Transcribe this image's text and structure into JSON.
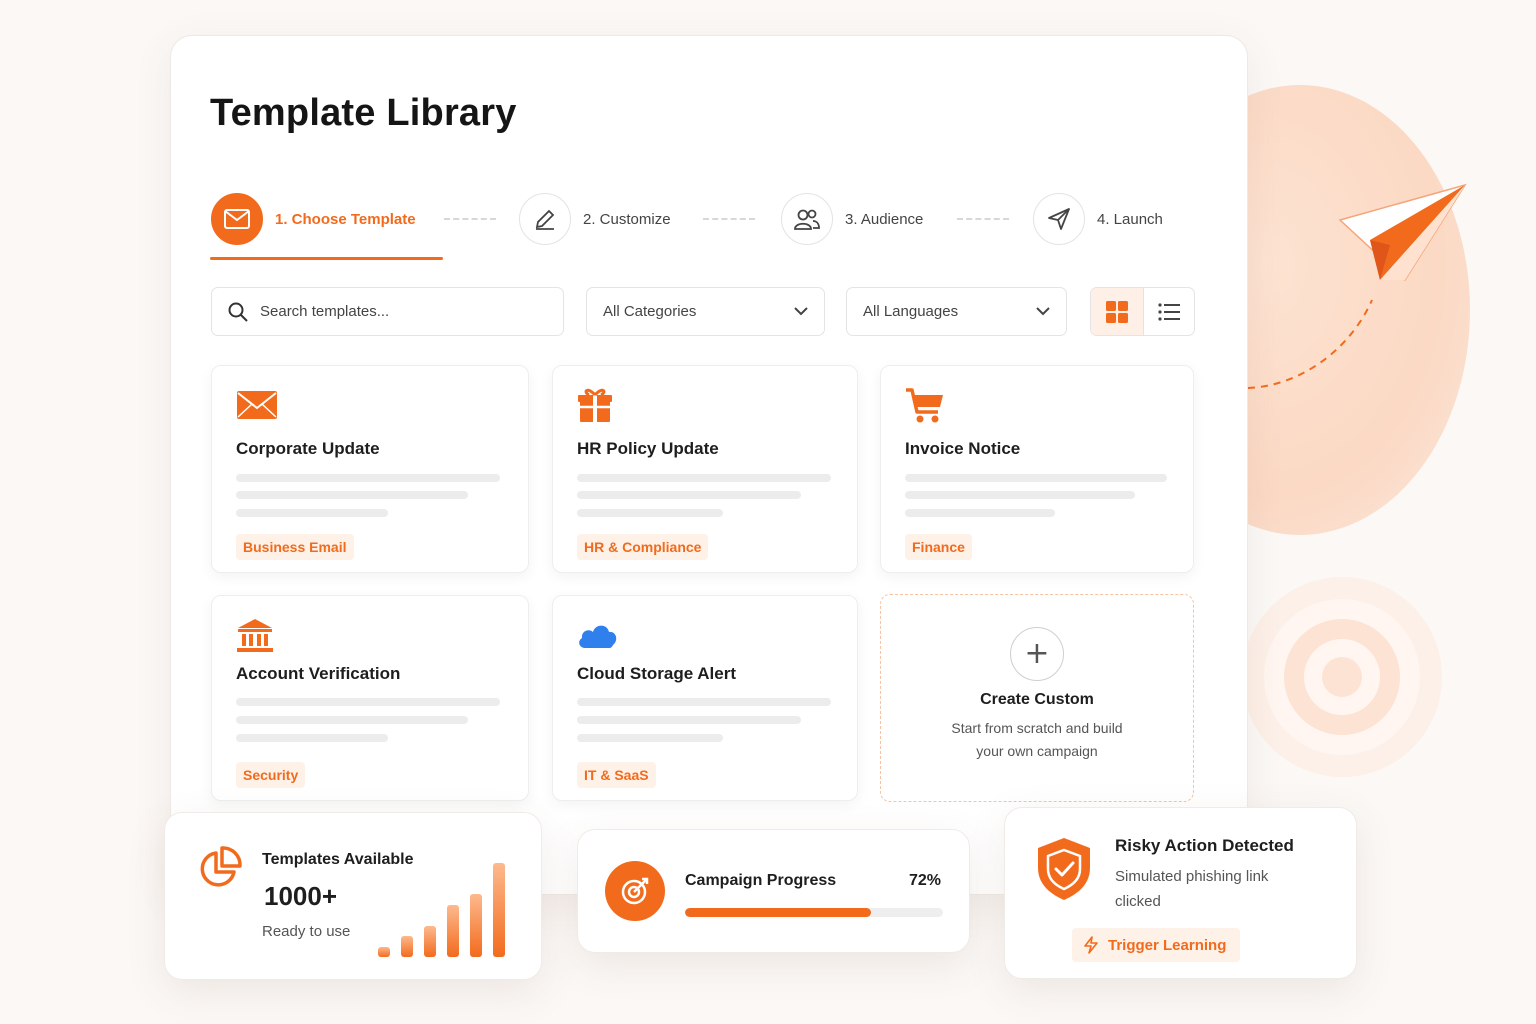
{
  "page": {
    "title": "Template Library"
  },
  "stepper": [
    {
      "label": "1. Choose Template",
      "icon": "envelope-icon",
      "active": true
    },
    {
      "label": "2. Customize",
      "icon": "pencil-icon",
      "active": false
    },
    {
      "label": "3. Audience",
      "icon": "users-icon",
      "active": false
    },
    {
      "label": "4. Launch",
      "icon": "paper-plane-icon",
      "active": false
    }
  ],
  "toolbar": {
    "search_placeholder": "Search templates...",
    "category_value": "All Categories",
    "language_value": "All Languages",
    "view_mode": "grid"
  },
  "templates": [
    {
      "name": "Corporate Update",
      "tag": "Business Email",
      "icon": "envelope-icon"
    },
    {
      "name": "HR Policy Update",
      "tag": "HR & Compliance",
      "icon": "gift-icon"
    },
    {
      "name": "Invoice Notice",
      "tag": "Finance",
      "icon": "cart-icon"
    },
    {
      "name": "Account Verification",
      "tag": "Security",
      "icon": "bank-icon"
    },
    {
      "name": "Cloud Storage Alert",
      "tag": "IT & SaaS",
      "icon": "cloud-icon"
    }
  ],
  "create_custom": {
    "title": "Create Custom",
    "description": "Start from scratch and build your own campaign"
  },
  "stats": {
    "title": "Templates Available",
    "value": "1000+",
    "subtitle": "Ready to use",
    "bars": [
      1,
      2,
      3,
      5,
      6,
      9
    ]
  },
  "progress": {
    "title": "Campaign Progress",
    "percent_label": "72%",
    "value": 0.72
  },
  "risk": {
    "title": "Risky Action Detected",
    "description": "Simulated phishing link clicked",
    "button_label": "Trigger Learning"
  },
  "colors": {
    "accent": "#f26b1d",
    "accent_light": "#fef1e8",
    "cloud_blue": "#2f80ed"
  }
}
